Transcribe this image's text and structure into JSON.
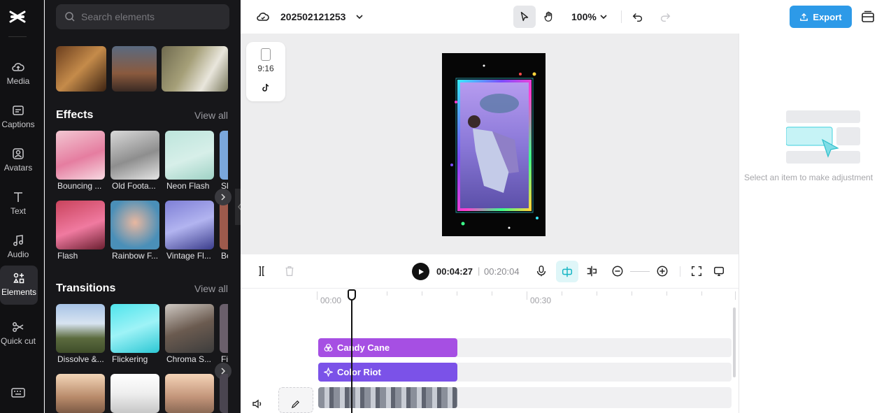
{
  "rail": {
    "items": [
      {
        "label": "Media",
        "icon": "cloud-upload-icon"
      },
      {
        "label": "Captions",
        "icon": "captions-icon"
      },
      {
        "label": "Avatars",
        "icon": "avatar-icon"
      },
      {
        "label": "Text",
        "icon": "text-icon"
      },
      {
        "label": "Audio",
        "icon": "music-note-icon"
      },
      {
        "label": "Elements",
        "icon": "elements-icon",
        "active": true
      },
      {
        "label": "Quick cut",
        "icon": "quick-cut-icon"
      }
    ]
  },
  "panel": {
    "search_placeholder": "Search elements",
    "effects": {
      "title": "Effects",
      "view_all": "View all",
      "row1": [
        "Bouncing ...",
        "Old Foota...",
        "Neon Flash",
        "Sl"
      ],
      "row2": [
        "Flash",
        "Rainbow F...",
        "Vintage Fl...",
        "Be"
      ]
    },
    "transitions": {
      "title": "Transitions",
      "view_all": "View all",
      "row1": [
        "Dissolve &...",
        "Flickering",
        "Chroma S...",
        "Fi"
      ]
    }
  },
  "topbar": {
    "project_name": "202502121253",
    "zoom": "100%",
    "export_label": "Export"
  },
  "canvas": {
    "ratio": "9:16"
  },
  "props": {
    "hint": "Select an item to make adjustment"
  },
  "player": {
    "current_time": "00:04:27",
    "separator": "|",
    "total_time": "00:20:04"
  },
  "timeline": {
    "ruler": [
      "00:00",
      "00:30"
    ],
    "clips": [
      {
        "label": "Candy Cane",
        "color": "#a64fe3"
      },
      {
        "label": "Color Riot",
        "color": "#7b52e8"
      }
    ]
  },
  "colors": {
    "accent": "#2d9ae8",
    "rail_bg": "#111113",
    "panel_bg": "#17171a"
  }
}
